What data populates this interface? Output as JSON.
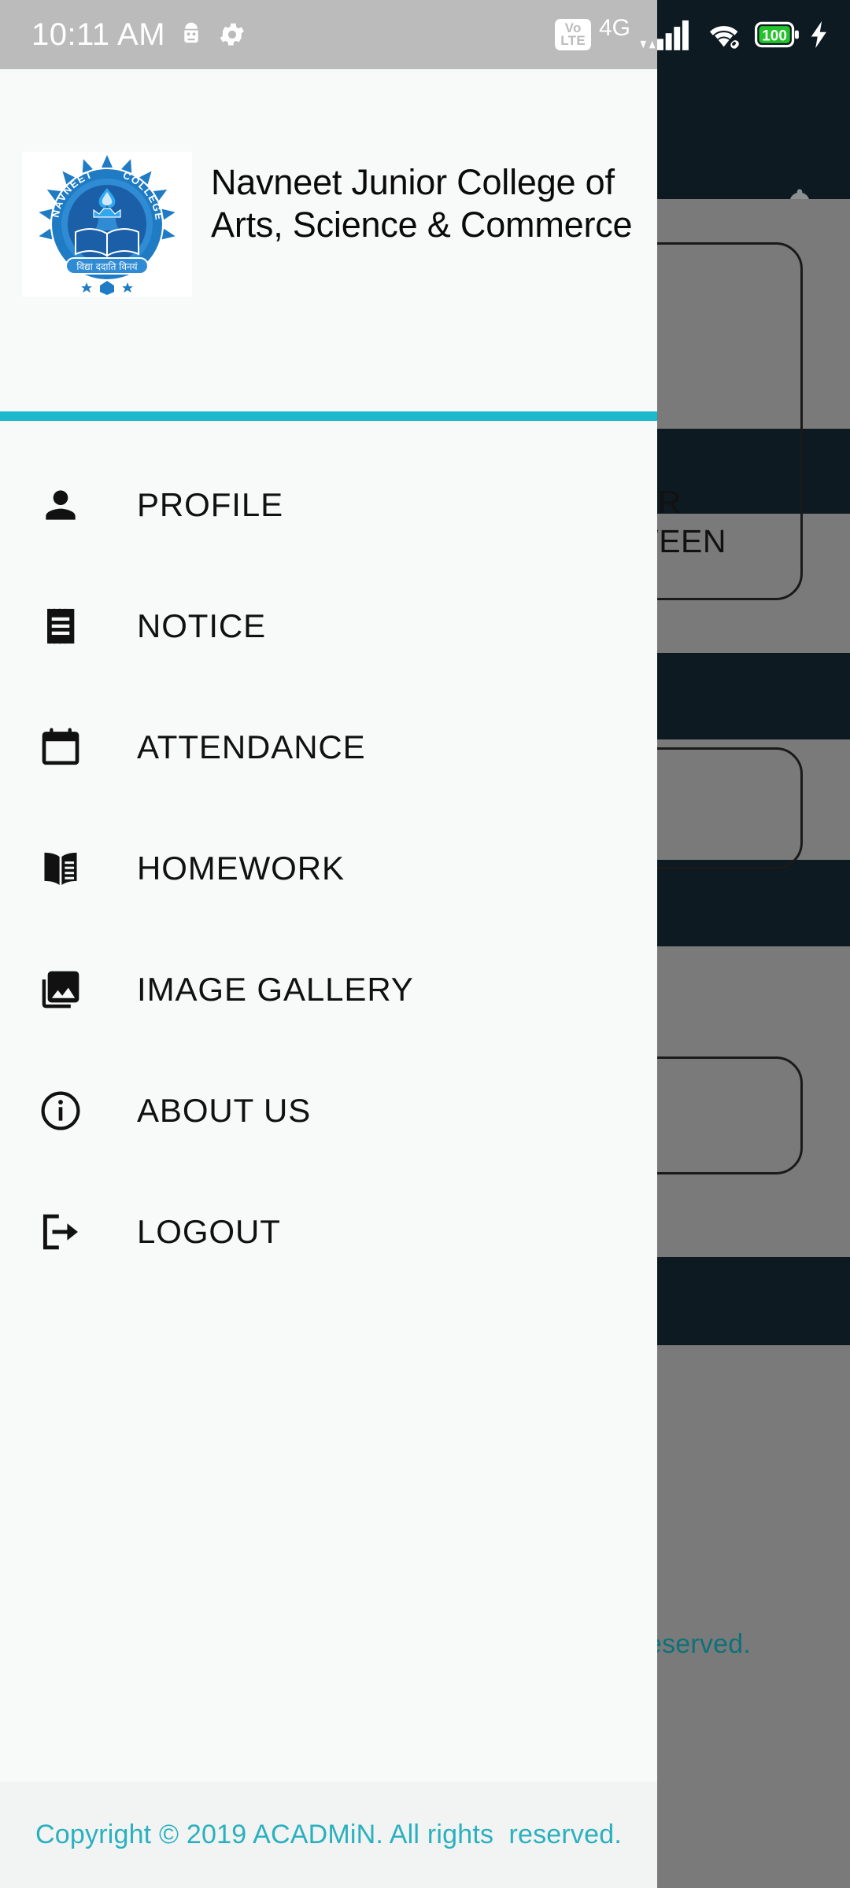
{
  "status_bar": {
    "time": "10:11 AM",
    "left_icons": [
      "android-robot-icon",
      "gear-icon"
    ],
    "network_label": "4G",
    "volte_line1": "Vo",
    "volte_line2": "LTE",
    "right_icons": [
      "signal-bars-icon",
      "wifi-icon",
      "battery-icon",
      "charging-bolt-icon"
    ],
    "battery_level": "100",
    "bar_color": "#BBBBBB",
    "text_color": "#FFFFFF"
  },
  "drawer": {
    "header": {
      "logo_name": "navneet-college-logo",
      "logo_arc_left": "NAVNEET",
      "logo_arc_right": "COLLEGE",
      "logo_motto": "विद्या ददाति विनयं",
      "title": "Navneet Junior College of Arts, Science & Commerce"
    },
    "accent_color": "#1CB8CC",
    "background_color": "#F8F9F9",
    "items": [
      {
        "label": "PROFILE",
        "icon": "person-icon"
      },
      {
        "label": "NOTICE",
        "icon": "receipt-icon"
      },
      {
        "label": "ATTENDANCE",
        "icon": "calendar-icon"
      },
      {
        "label": "HOMEWORK",
        "icon": "open-book-icon"
      },
      {
        "label": "IMAGE GALLERY",
        "icon": "photo-library-icon"
      },
      {
        "label": "ABOUT US",
        "icon": "info-circle-icon"
      },
      {
        "label": "LOGOUT",
        "icon": "logout-icon"
      }
    ],
    "footer": {
      "copyright": "Copyright © 2019 ACADMiN. All rights  reserved.",
      "color": "#2AB0BE"
    }
  },
  "background_app": {
    "appbar": {
      "color": "#0D1A21",
      "notification_icon": "bell-icon"
    },
    "scrim_color": "#7A7A7A",
    "card_text_top": "BAR\nRVEEN",
    "footer_text": "eserved.",
    "band_color": "#0D1A21"
  }
}
